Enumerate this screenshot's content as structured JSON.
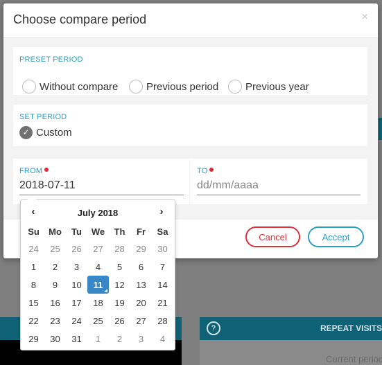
{
  "background": {
    "repeat_visits": "REPEAT VISITS",
    "current_period": "Current period",
    "help_glyph": "?"
  },
  "modal": {
    "title": "Choose compare period",
    "close_glyph": "×",
    "preset": {
      "label": "PRESET PERIOD",
      "options": [
        "Without compare",
        "Previous period",
        "Previous year"
      ]
    },
    "set": {
      "label": "SET PERIOD",
      "option": "Custom",
      "check_glyph": "✓"
    },
    "from": {
      "label": "FROM",
      "value": "2018-07-11"
    },
    "to": {
      "label": "TO",
      "value": "",
      "placeholder": "dd/mm/aaaa"
    },
    "buttons": {
      "cancel": "Cancel",
      "accept": "Accept"
    }
  },
  "datepicker": {
    "month": "July 2018",
    "prev_glyph": "‹",
    "next_glyph": "›",
    "weekdays": [
      "Su",
      "Mo",
      "Tu",
      "We",
      "Th",
      "Fr",
      "Sa"
    ],
    "selected": "11",
    "weeks": [
      [
        "24",
        "25",
        "26",
        "27",
        "28",
        "29",
        "30"
      ],
      [
        "1",
        "2",
        "3",
        "4",
        "5",
        "6",
        "7"
      ],
      [
        "8",
        "9",
        "10",
        "11",
        "12",
        "13",
        "14"
      ],
      [
        "15",
        "16",
        "17",
        "18",
        "19",
        "20",
        "21"
      ],
      [
        "22",
        "23",
        "24",
        "25",
        "26",
        "27",
        "28"
      ],
      [
        "29",
        "30",
        "31",
        "1",
        "2",
        "3",
        "4"
      ]
    ]
  }
}
